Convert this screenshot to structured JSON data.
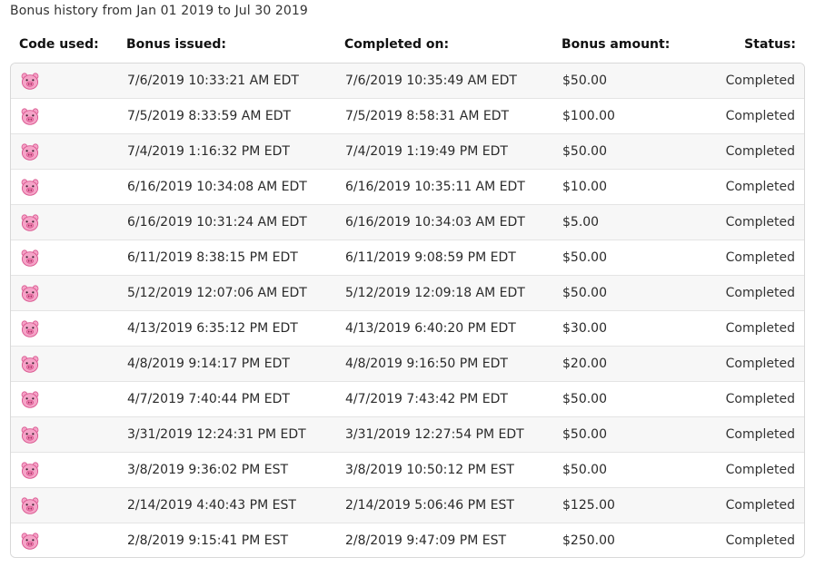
{
  "page": {
    "title": "Bonus history from Jan 01 2019 to Jul 30 2019"
  },
  "table": {
    "headers": {
      "code": "Code used:",
      "issued": "Bonus issued:",
      "completed": "Completed on:",
      "amount": "Bonus amount:",
      "status": "Status:"
    },
    "code_icon": "pig-face-icon",
    "rows": [
      {
        "issued": "7/6/2019 10:33:21 AM EDT",
        "completed": "7/6/2019 10:35:49 AM EDT",
        "amount": "$50.00",
        "status": "Completed"
      },
      {
        "issued": "7/5/2019 8:33:59 AM EDT",
        "completed": "7/5/2019 8:58:31 AM EDT",
        "amount": "$100.00",
        "status": "Completed"
      },
      {
        "issued": "7/4/2019 1:16:32 PM EDT",
        "completed": "7/4/2019 1:19:49 PM EDT",
        "amount": "$50.00",
        "status": "Completed"
      },
      {
        "issued": "6/16/2019 10:34:08 AM EDT",
        "completed": "6/16/2019 10:35:11 AM EDT",
        "amount": "$10.00",
        "status": "Completed"
      },
      {
        "issued": "6/16/2019 10:31:24 AM EDT",
        "completed": "6/16/2019 10:34:03 AM EDT",
        "amount": "$5.00",
        "status": "Completed"
      },
      {
        "issued": "6/11/2019 8:38:15 PM EDT",
        "completed": "6/11/2019 9:08:59 PM EDT",
        "amount": "$50.00",
        "status": "Completed"
      },
      {
        "issued": "5/12/2019 12:07:06 AM EDT",
        "completed": "5/12/2019 12:09:18 AM EDT",
        "amount": "$50.00",
        "status": "Completed"
      },
      {
        "issued": "4/13/2019 6:35:12 PM EDT",
        "completed": "4/13/2019 6:40:20 PM EDT",
        "amount": "$30.00",
        "status": "Completed"
      },
      {
        "issued": "4/8/2019 9:14:17 PM EDT",
        "completed": "4/8/2019 9:16:50 PM EDT",
        "amount": "$20.00",
        "status": "Completed"
      },
      {
        "issued": "4/7/2019 7:40:44 PM EDT",
        "completed": "4/7/2019 7:43:42 PM EDT",
        "amount": "$50.00",
        "status": "Completed"
      },
      {
        "issued": "3/31/2019 12:24:31 PM EDT",
        "completed": "3/31/2019 12:27:54 PM EDT",
        "amount": "$50.00",
        "status": "Completed"
      },
      {
        "issued": "3/8/2019 9:36:02 PM EST",
        "completed": "3/8/2019 10:50:12 PM EST",
        "amount": "$50.00",
        "status": "Completed"
      },
      {
        "issued": "2/14/2019 4:40:43 PM EST",
        "completed": "2/14/2019 5:06:46 PM EST",
        "amount": "$125.00",
        "status": "Completed"
      },
      {
        "issued": "2/8/2019 9:15:41 PM EST",
        "completed": "2/8/2019 9:47:09 PM EST",
        "amount": "$250.00",
        "status": "Completed"
      }
    ]
  },
  "colors": {
    "pig_fill": "#f5a3c7",
    "pig_dark": "#d9568f",
    "row_stripe": "#f7f7f7",
    "border": "#d8d8d8"
  }
}
